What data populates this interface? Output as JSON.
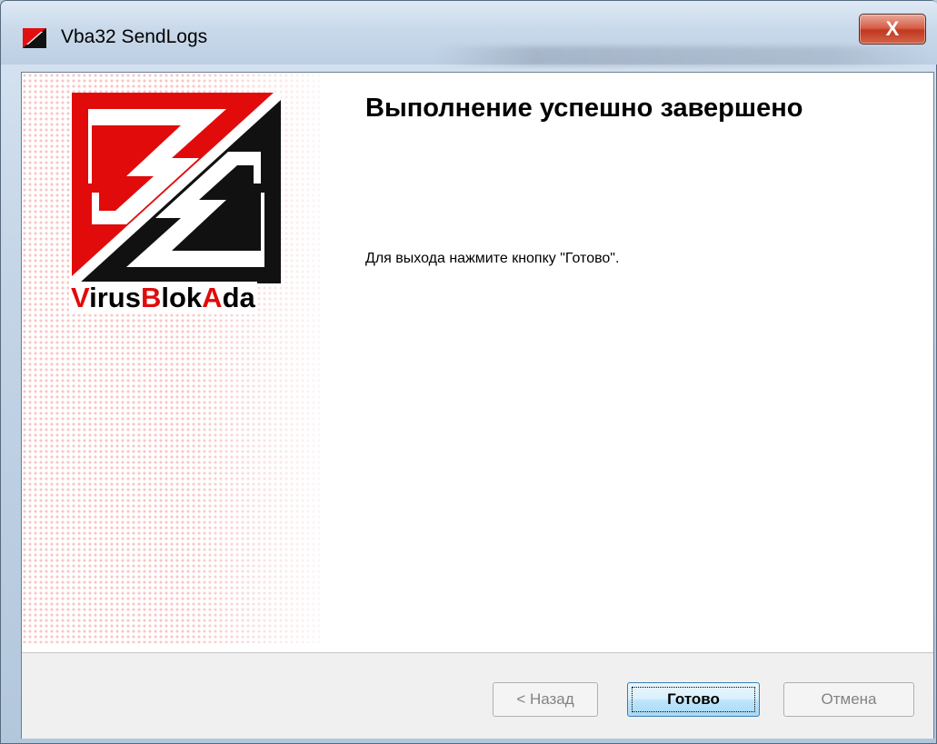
{
  "window": {
    "title": "Vba32 SendLogs",
    "close_glyph": "X",
    "background_hint": "Для выхода нажмите кнопку \"Готово\""
  },
  "sidebar": {
    "logo_icon": "virusblokada-logo-icon",
    "brand_parts": [
      "V",
      "irus",
      "B",
      "lok",
      "A",
      "da"
    ],
    "colors": {
      "red": "#e10b0b",
      "black": "#000000"
    }
  },
  "content": {
    "heading": "Выполнение успешно завершено",
    "message": "Для выхода нажмите кнопку \"Готово\"."
  },
  "buttons": {
    "back": "< Назад",
    "finish": "Готово",
    "cancel": "Отмена"
  }
}
